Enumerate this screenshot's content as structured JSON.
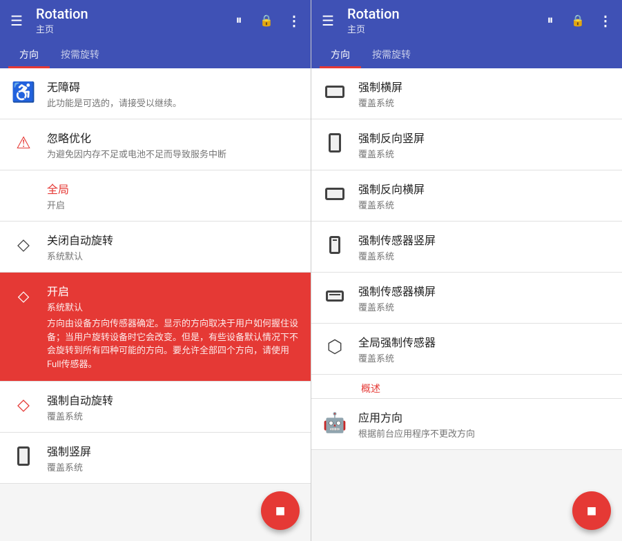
{
  "left_panel": {
    "header": {
      "title": "Rotation",
      "subtitle": "主页",
      "pause_icon": "pause",
      "lock_icon": "lock",
      "more_icon": "more"
    },
    "tabs": [
      {
        "label": "方向",
        "active": true
      },
      {
        "label": "按需旋转",
        "active": false
      }
    ],
    "items": [
      {
        "id": "accessibility",
        "icon": "accessibility",
        "title": "无障碍",
        "subtitle": "此功能是可选的，请接受以继续。",
        "highlight": false,
        "title_color": "normal"
      },
      {
        "id": "ignore-optimization",
        "icon": "warning",
        "title": "忽略优化",
        "subtitle": "为避免因内存不足或电池不足而导致服务中断",
        "highlight": false,
        "title_color": "normal"
      },
      {
        "id": "global",
        "icon": "none",
        "title": "全局",
        "subtitle": "开启",
        "highlight": false,
        "title_color": "red"
      },
      {
        "id": "close-rotation",
        "icon": "device",
        "title": "关闭自动旋转",
        "subtitle": "系统默认",
        "highlight": false,
        "title_color": "normal"
      },
      {
        "id": "enable",
        "icon": "rotate",
        "title": "开启",
        "subtitle": "系统默认",
        "desc": "方向由设备方向传感器确定。显示的方向取决于用户如何握住设备；当用户旋转设备时它会改变。但是，有些设备默认情况下不会旋转到所有四种可能的方向。要允许全部四个方向，请使用Full传感器。",
        "highlight": true,
        "title_color": "white"
      },
      {
        "id": "force-auto",
        "icon": "device",
        "title": "强制自动旋转",
        "subtitle": "覆盖系统",
        "highlight": false,
        "title_color": "normal"
      },
      {
        "id": "force-portrait",
        "icon": "screen-v",
        "title": "强制竖屏",
        "subtitle": "覆盖系统",
        "highlight": false,
        "title_color": "normal"
      }
    ],
    "fab": "■"
  },
  "right_panel": {
    "header": {
      "title": "Rotation",
      "subtitle": "主页",
      "pause_icon": "pause",
      "lock_icon": "lock",
      "more_icon": "more"
    },
    "tabs": [
      {
        "label": "方向",
        "active": true
      },
      {
        "label": "按需旋转",
        "active": false
      }
    ],
    "items": [
      {
        "id": "force-landscape",
        "icon": "screen-h",
        "title": "强制横屏",
        "subtitle": "覆盖系统"
      },
      {
        "id": "force-reverse-portrait",
        "icon": "screen-v-flip",
        "title": "强制反向竖屏",
        "subtitle": "覆盖系统"
      },
      {
        "id": "force-reverse-landscape",
        "icon": "screen-h-flip",
        "title": "强制反向横屏",
        "subtitle": "覆盖系统"
      },
      {
        "id": "force-sensor-portrait",
        "icon": "sensor-v",
        "title": "强制传感器竖屏",
        "subtitle": "覆盖系统"
      },
      {
        "id": "force-sensor-landscape",
        "icon": "sensor-h",
        "title": "强制传感器横屏",
        "subtitle": "覆盖系统"
      },
      {
        "id": "full-force-sensor",
        "icon": "sensor-full",
        "title": "全局强制传感器",
        "subtitle": "覆盖系统"
      },
      {
        "id": "overview-label",
        "type": "section",
        "title": "概述"
      },
      {
        "id": "app-direction",
        "icon": "android",
        "title": "应用方向",
        "subtitle": "根据前台应用程序不更改方向"
      }
    ],
    "fab": "■"
  }
}
